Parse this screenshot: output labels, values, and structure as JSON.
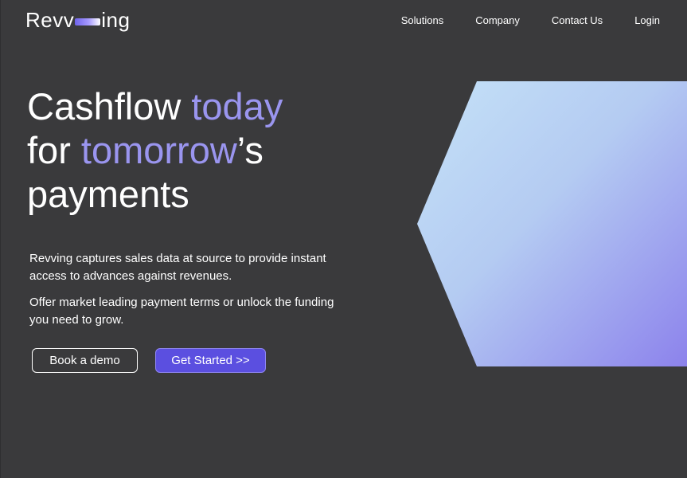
{
  "brand": {
    "name_prefix": "Revv",
    "name_suffix": "ing",
    "accent_color": "#9a95ef",
    "button_color": "#5b4fe0",
    "background_color": "#3a3a3c"
  },
  "nav": {
    "items": [
      {
        "label": "Solutions"
      },
      {
        "label": "Company"
      },
      {
        "label": "Contact Us"
      },
      {
        "label": "Login"
      }
    ]
  },
  "hero": {
    "headline": {
      "part1": "Cashflow ",
      "accent1": "today",
      "part2": "for ",
      "accent2": "tomorrow",
      "part3": "’s",
      "part4": "payments"
    },
    "description_1": "Revving captures sales data at source to provide instant access to advances against revenues.",
    "description_2": "Offer market leading payment terms or unlock the funding you need to grow.",
    "primary_cta": "Get Started >>",
    "secondary_cta": "Book a demo",
    "graphic": {
      "shape": "hexagon",
      "gradient_start": "#c3e0f6",
      "gradient_end": "#8f85ec"
    }
  }
}
